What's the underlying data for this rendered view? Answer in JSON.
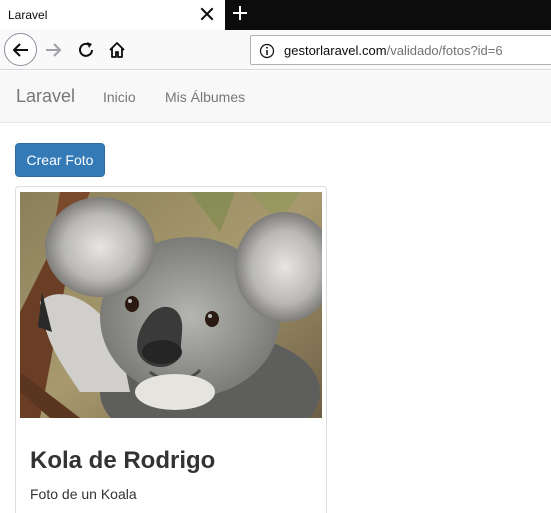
{
  "browser": {
    "tab_title": "Laravel",
    "url_domain": "gestorlaravel.com",
    "url_path": "/validado/fotos?id=6"
  },
  "navbar": {
    "brand": "Laravel",
    "items": [
      {
        "label": "Inicio"
      },
      {
        "label": "Mis Álbumes"
      }
    ]
  },
  "main": {
    "create_button": "Crear Foto",
    "photo": {
      "title": "Kola de Rodrigo",
      "description": "Foto de un Koala",
      "image_subject": "koala"
    }
  },
  "colors": {
    "primary": "#337ab7",
    "navbar_bg": "#f8f8f8",
    "tabstrip_bg": "#0c0c0d"
  },
  "icons": [
    "close-icon",
    "plus-icon",
    "back-arrow-icon",
    "forward-arrow-icon",
    "reload-icon",
    "home-icon",
    "info-icon"
  ]
}
